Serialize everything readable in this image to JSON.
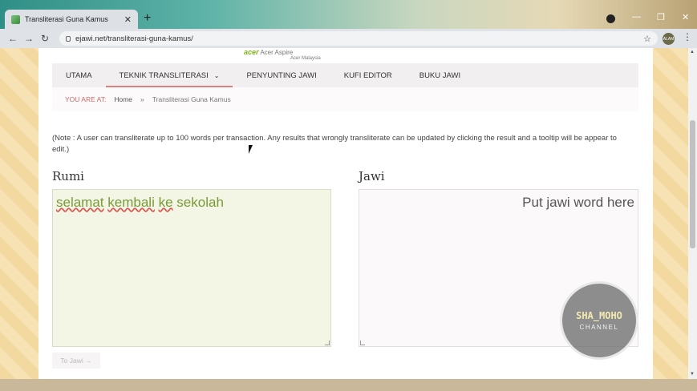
{
  "browser": {
    "tab_title": "Transliterasi Guna Kamus",
    "tab_close": "✕",
    "new_tab": "+",
    "url": "ejawi.net/transliterasi-guna-kamus/",
    "profile": "ALAM"
  },
  "site": {
    "logo_brand": "acer",
    "logo_line1": "Acer Aspire",
    "logo_line2": "Acer Malaysia"
  },
  "nav": {
    "items": [
      {
        "label": "UTAMA"
      },
      {
        "label": "TEKNIK TRANSLITERASI",
        "has_dropdown": true,
        "active": true
      },
      {
        "label": "PENYUNTING JAWI"
      },
      {
        "label": "KUFI EDITOR"
      },
      {
        "label": "BUKU JAWI"
      }
    ]
  },
  "breadcrumb": {
    "lead": "YOU ARE AT:",
    "home": "Home",
    "separator": "»",
    "current": "Transliterasi Guna Kamus"
  },
  "note": "(Note : A user can transliterate up to 100 words per transaction. Any results that wrongly transliterate can be updated by clicking the result and a tooltip will be appear to edit.)",
  "rumi": {
    "label": "Rumi",
    "words": [
      "selamat",
      "kembali",
      "ke",
      "sekolah"
    ]
  },
  "jawi": {
    "label": "Jawi",
    "placeholder": "Put jawi word here"
  },
  "convert_button": "To Jawi →",
  "watermark": {
    "top": "SHA_MOHO",
    "bottom": "CHANNEL"
  },
  "colors": {
    "accent": "#e0807d",
    "rumi_bg": "#f3f6e4",
    "rumi_text": "#7a9a3a"
  }
}
